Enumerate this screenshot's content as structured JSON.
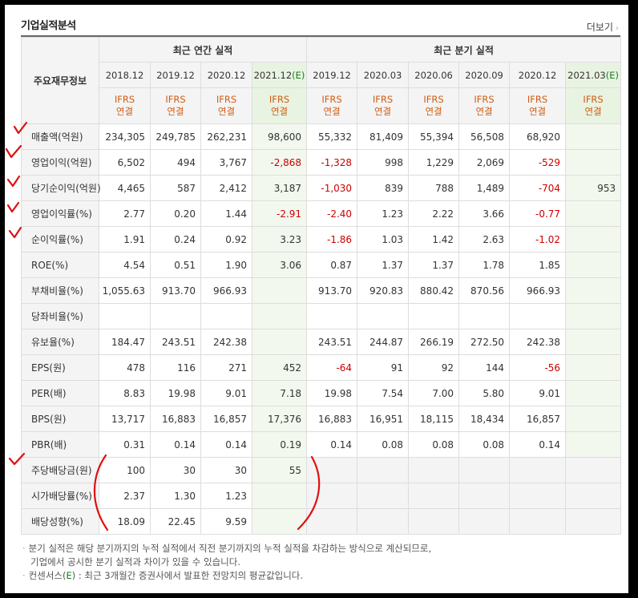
{
  "section": {
    "title": "기업실적분석",
    "more_label": "더보기"
  },
  "table": {
    "label_header": "주요재무정보",
    "groups": {
      "annual": "최근 연간 실적",
      "quarterly": "최근 분기 실적"
    },
    "periods": [
      "2018.12",
      "2019.12",
      "2020.12",
      "2021.12",
      "2019.12",
      "2020.03",
      "2020.06",
      "2020.09",
      "2020.12",
      "2021.03"
    ],
    "estimate_mark": "(E)",
    "basis_line1": "IFRS",
    "basis_line2": "연결",
    "rows": [
      {
        "label": "매출액(억원)",
        "values": [
          "234,305",
          "249,785",
          "262,231",
          "98,600",
          "55,332",
          "81,409",
          "55,394",
          "56,508",
          "68,920",
          ""
        ]
      },
      {
        "label": "영업이익(억원)",
        "values": [
          "6,502",
          "494",
          "3,767",
          "-2,868",
          "-1,328",
          "998",
          "1,229",
          "2,069",
          "-529",
          ""
        ]
      },
      {
        "label": "당기순이익(억원)",
        "values": [
          "4,465",
          "587",
          "2,412",
          "3,187",
          "-1,030",
          "839",
          "788",
          "1,489",
          "-704",
          "953"
        ]
      },
      {
        "label": "영업이익률(%)",
        "values": [
          "2.77",
          "0.20",
          "1.44",
          "-2.91",
          "-2.40",
          "1.23",
          "2.22",
          "3.66",
          "-0.77",
          ""
        ]
      },
      {
        "label": "순이익률(%)",
        "values": [
          "1.91",
          "0.24",
          "0.92",
          "3.23",
          "-1.86",
          "1.03",
          "1.42",
          "2.63",
          "-1.02",
          ""
        ]
      },
      {
        "label": "ROE(%)",
        "values": [
          "4.54",
          "0.51",
          "1.90",
          "3.06",
          "0.87",
          "1.37",
          "1.37",
          "1.78",
          "1.85",
          ""
        ]
      },
      {
        "label": "부채비율(%)",
        "values": [
          "1,055.63",
          "913.70",
          "966.93",
          "",
          "913.70",
          "920.83",
          "880.42",
          "870.56",
          "966.93",
          ""
        ]
      },
      {
        "label": "당좌비율(%)",
        "values": [
          "",
          "",
          "",
          "",
          "",
          "",
          "",
          "",
          "",
          ""
        ]
      },
      {
        "label": "유보율(%)",
        "values": [
          "184.47",
          "243.51",
          "242.38",
          "",
          "243.51",
          "244.87",
          "266.19",
          "272.50",
          "242.38",
          ""
        ]
      },
      {
        "label": "EPS(원)",
        "values": [
          "478",
          "116",
          "271",
          "452",
          "-64",
          "91",
          "92",
          "144",
          "-56",
          ""
        ]
      },
      {
        "label": "PER(배)",
        "values": [
          "8.83",
          "19.98",
          "9.01",
          "7.18",
          "19.98",
          "7.54",
          "7.00",
          "5.80",
          "9.01",
          ""
        ]
      },
      {
        "label": "BPS(원)",
        "values": [
          "13,717",
          "16,883",
          "16,857",
          "17,376",
          "16,883",
          "16,951",
          "18,115",
          "18,434",
          "16,857",
          ""
        ]
      },
      {
        "label": "PBR(배)",
        "values": [
          "0.31",
          "0.14",
          "0.14",
          "0.19",
          "0.14",
          "0.08",
          "0.08",
          "0.08",
          "0.14",
          ""
        ]
      },
      {
        "label": "주당배당금(원)",
        "values": [
          "100",
          "30",
          "30",
          "55",
          "",
          "",
          "",
          "",
          "",
          ""
        ]
      },
      {
        "label": "시가배당률(%)",
        "values": [
          "2.37",
          "1.30",
          "1.23",
          "",
          "",
          "",
          "",
          "",
          "",
          ""
        ]
      },
      {
        "label": "배당성향(%)",
        "values": [
          "18.09",
          "22.45",
          "9.59",
          "",
          "",
          "",
          "",
          "",
          "",
          ""
        ]
      }
    ]
  },
  "notes": {
    "line1": "분기 실적은 해당 분기까지의 누적 실적에서 직전 분기까지의 누적 실적을 차감하는 방식으로 계산되므로,",
    "line2": "기업에서 공시한 분기 실적과 차이가 있을 수 있습니다.",
    "line3_prefix": "컨센서스(",
    "line3_mark": "E",
    "line3_suffix": ") : 최근 3개월간 증권사에서 발표한 전망치의 평균값입니다."
  },
  "annotations": {
    "color": "#e01010"
  }
}
